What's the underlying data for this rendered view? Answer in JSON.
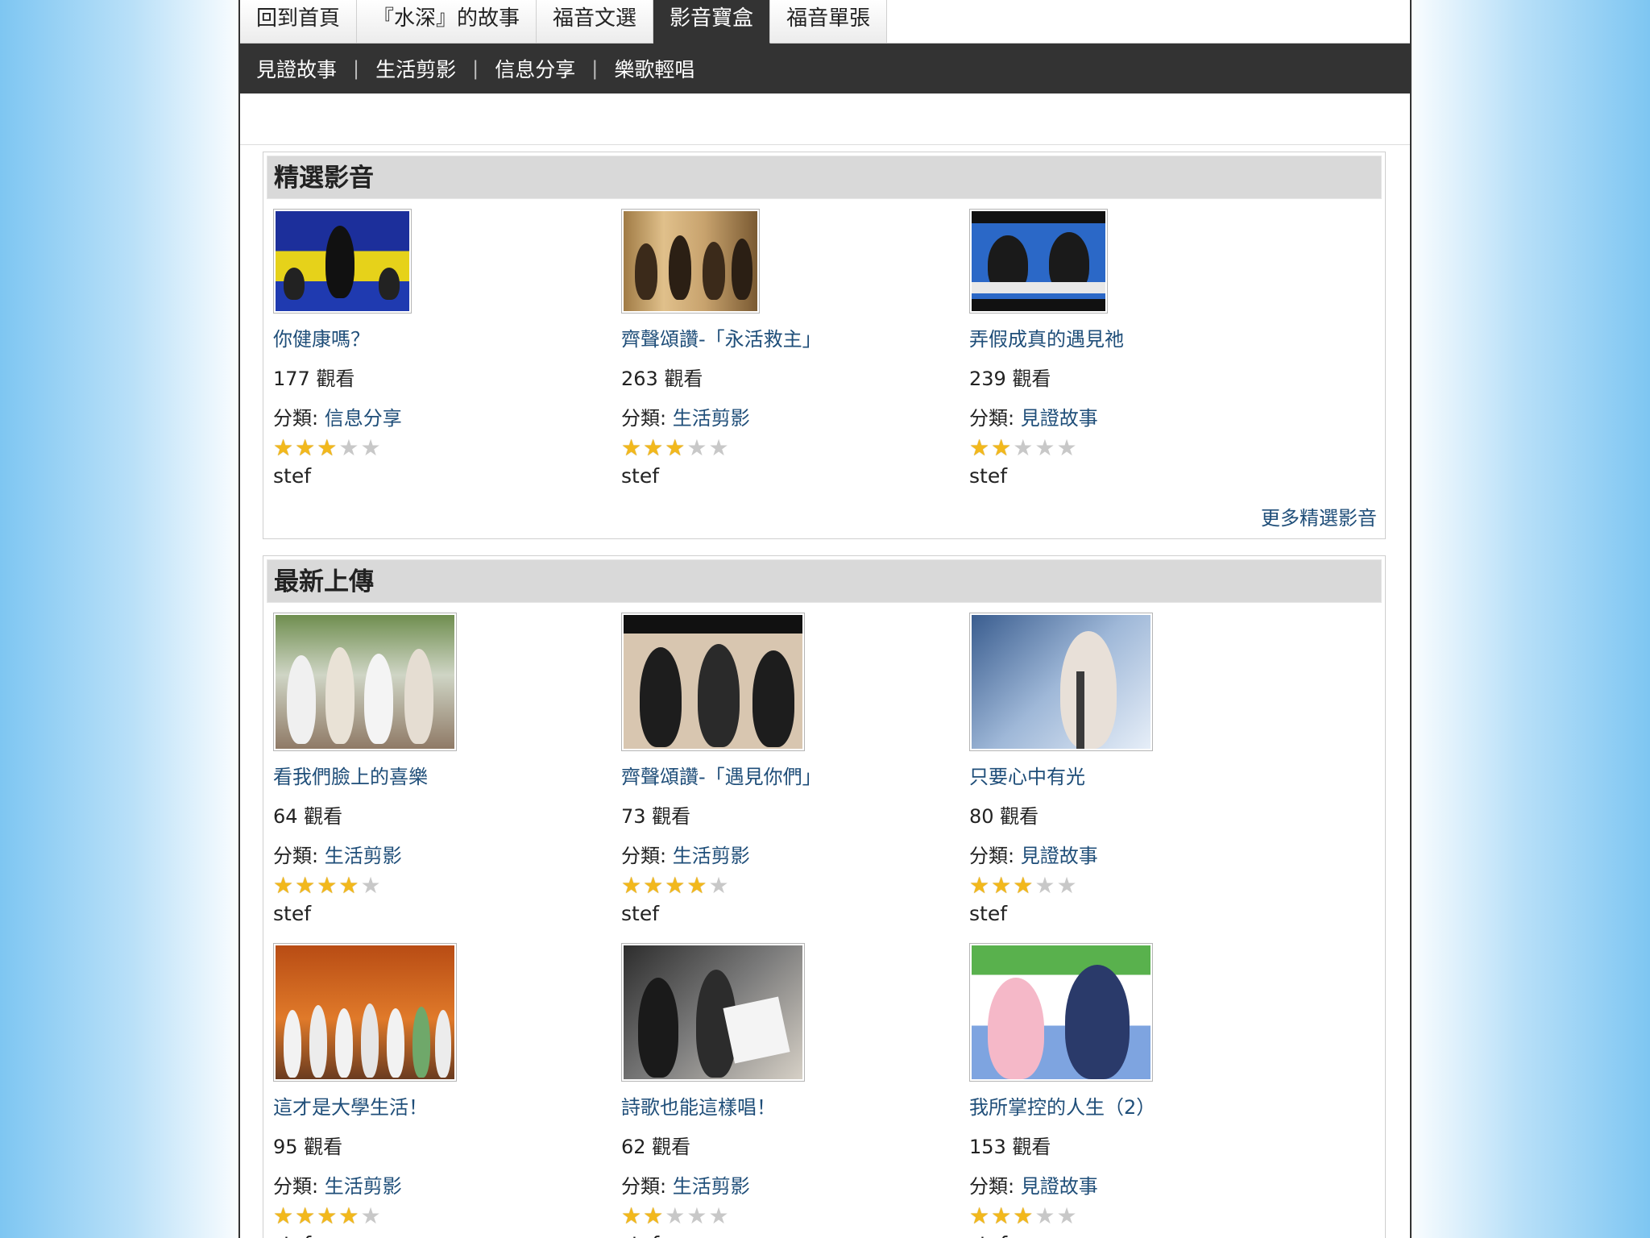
{
  "topnav": {
    "tabs": [
      {
        "label": "回到首頁",
        "active": false
      },
      {
        "label": "『水深』的故事",
        "active": false
      },
      {
        "label": "福音文選",
        "active": false
      },
      {
        "label": "影音寶盒",
        "active": true
      },
      {
        "label": "福音單張",
        "active": false
      }
    ]
  },
  "subnav": {
    "items": [
      "見證故事",
      "生活剪影",
      "信息分享",
      "樂歌輕唱"
    ]
  },
  "featured": {
    "title": "精選影音",
    "more_link": "更多精選影音",
    "videos": [
      {
        "title": "你健康嗎？",
        "views": "177 觀看",
        "category_label": "分類:",
        "category": "信息分享",
        "rating": 3,
        "user": "stef",
        "thumb": "speaker-at-podium"
      },
      {
        "title": "齊聲頌讚-「永活救主」",
        "views": "263 觀看",
        "category_label": "分類:",
        "category": "生活剪影",
        "rating": 3,
        "user": "stef",
        "thumb": "guitar-band"
      },
      {
        "title": "弄假成真的遇見祂",
        "views": "239 觀看",
        "category_label": "分類:",
        "category": "見證故事",
        "rating": 2,
        "user": "stef",
        "thumb": "two-men-interview"
      }
    ]
  },
  "latest": {
    "title": "最新上傳",
    "videos": [
      {
        "title": "看我們臉上的喜樂",
        "views": "64 觀看",
        "category_label": "分類:",
        "category": "生活剪影",
        "rating": 4,
        "user": "stef",
        "thumb": "group-photo"
      },
      {
        "title": "齊聲頌讚-「遇見你們」",
        "views": "73 觀看",
        "category_label": "分類:",
        "category": "生活剪影",
        "rating": 4,
        "user": "stef",
        "thumb": "women-singing"
      },
      {
        "title": "只要心中有光",
        "views": "80 觀看",
        "category_label": "分類:",
        "category": "見證故事",
        "rating": 3,
        "user": "stef",
        "thumb": "girl-with-mic"
      },
      {
        "title": "這才是大學生活！",
        "views": "95 觀看",
        "category_label": "分類:",
        "category": "生活剪影",
        "rating": 4,
        "user": "stef",
        "thumb": "choir-stage"
      },
      {
        "title": "詩歌也能這樣唱！",
        "views": "62 觀看",
        "category_label": "分類:",
        "category": "生活剪影",
        "rating": 2,
        "user": "stef",
        "thumb": "group-reading"
      },
      {
        "title": "我所掌控的人生（2）",
        "views": "153 觀看",
        "category_label": "分類:",
        "category": "見證故事",
        "rating": 3,
        "user": "stef",
        "thumb": "couple-interview"
      }
    ]
  },
  "colors": {
    "link": "#1f4e79",
    "nav_dark": "#333333",
    "section_head": "#d9d9d9",
    "star_on": "#f2b81c",
    "star_off": "#c8c8c8"
  }
}
